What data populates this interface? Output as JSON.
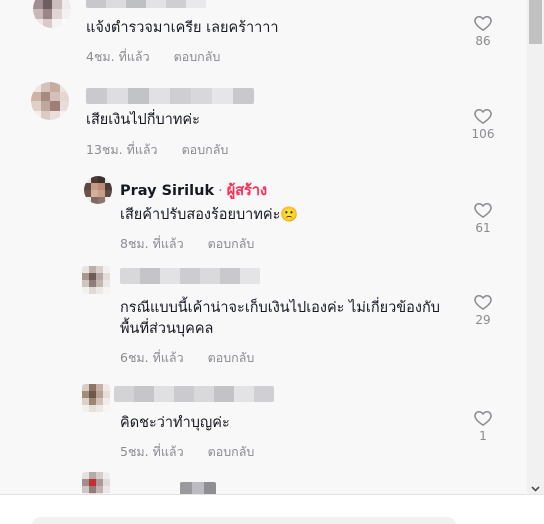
{
  "comments": [
    {
      "text": "แจ้งตำรวจมาเครีย เลยคร้าาาา",
      "time": "4ชม. ที่แล้ว",
      "reply": "ตอบกลับ",
      "likes": "86"
    },
    {
      "text": "เสียเงินไปกี่บาทค่ะ",
      "time": "13ชม. ที่แล้ว",
      "reply": "ตอบกลับ",
      "likes": "106"
    },
    {
      "author": "Pray Siriluk",
      "separator": "·",
      "badge": "ผู้สร้าง",
      "text": "เสียค้าปรับสองร้อยบาทค่ะ🙁",
      "time": "8ชม. ที่แล้ว",
      "reply": "ตอบกลับ",
      "likes": "61"
    },
    {
      "text": "กรณีแบบนี้เค้าน่าจะเก็บเงินไปเองค่ะ ไม่เกี่ยวข้องกับพื้นที่ส่วนบุคคล",
      "time": "6ชม. ที่แล้ว",
      "reply": "ตอบกลับ",
      "likes": "29"
    },
    {
      "text": "คิดชะว่าทำบุญค่ะ",
      "time": "5ชม. ที่แล้ว",
      "reply": "ตอบกลับ",
      "likes": "1"
    }
  ],
  "colors": {
    "creator_badge": "#fe2c55",
    "meta": "#8a8b91"
  },
  "icons": {
    "like": "heart-outline-icon",
    "scroll_down": "chevron-down-icon"
  }
}
